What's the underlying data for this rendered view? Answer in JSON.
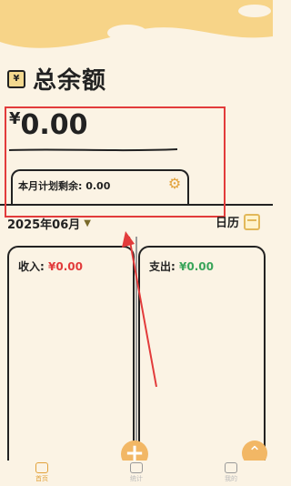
{
  "header": {
    "title": "总余额",
    "yen_badge": "¥"
  },
  "balance": {
    "currency": "¥",
    "amount": "0.00"
  },
  "plan": {
    "label": "本月计划剩余: 0.00"
  },
  "month": {
    "value": "2025年06月",
    "chevron": "chevron-down-icon"
  },
  "calendar": {
    "label": "日历"
  },
  "income": {
    "label": "收入:",
    "value": "¥0.00"
  },
  "expense": {
    "label": "支出:",
    "value": "¥0.00"
  },
  "tabs": [
    {
      "label": "首页"
    },
    {
      "label": "统计"
    },
    {
      "label": "我的"
    }
  ],
  "colors": {
    "income": "#e23b3b",
    "expense": "#3aa55a",
    "accent": "#f2b765",
    "highlight": "#e23b3b"
  }
}
